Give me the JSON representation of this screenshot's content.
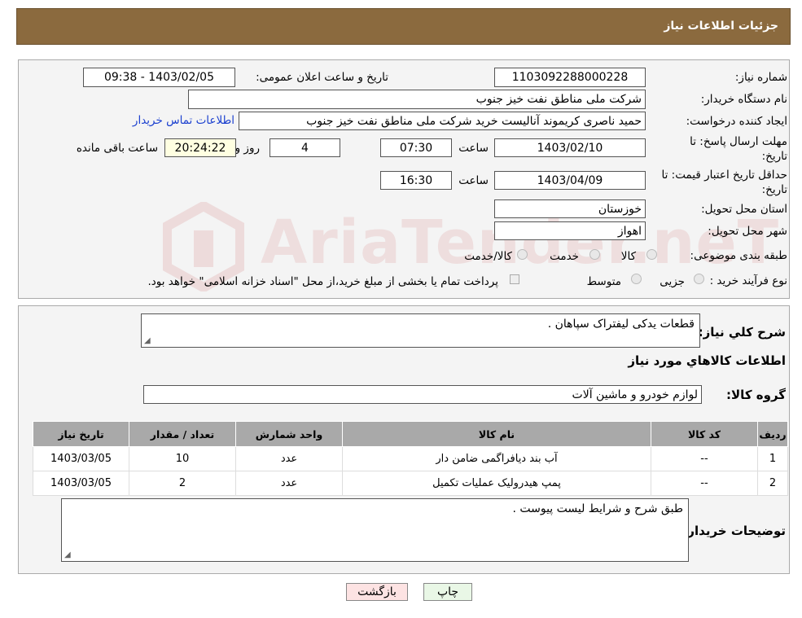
{
  "header": {
    "title": "جزئیات اطلاعات نیاز"
  },
  "form": {
    "need_number_label": "شماره نیاز:",
    "need_number": "1103092288000228",
    "announce_label": "تاریخ و ساعت اعلان عمومی:",
    "announce_value": "1403/02/05 - 09:38",
    "buyer_org_label": "نام دستگاه خریدار:",
    "buyer_org": "شرکت ملی مناطق نفت خیز جنوب",
    "creator_label": "ایجاد کننده درخواست:",
    "creator": "حمید ناصری کریموند آنالیست خرید شرکت ملی مناطق نفت خیز جنوب",
    "contact_link": "اطلاعات تماس خریدار",
    "deadline_label_1": "مهلت ارسال پاسخ: تا",
    "deadline_label_2": "تاریخ:",
    "deadline_date": "1403/02/10",
    "time_label": "ساعت",
    "deadline_time": "07:30",
    "days_value": "4",
    "days_label": "روز و",
    "remaining_value": "20:24:22",
    "remaining_label": "ساعت باقی مانده",
    "validity_label_1": "حداقل تاریخ اعتبار قیمت: تا",
    "validity_label_2": "تاریخ:",
    "validity_date": "1403/04/09",
    "validity_time": "16:30",
    "province_label": "استان محل تحویل:",
    "province": "خوزستان",
    "city_label": "شهر محل تحویل:",
    "city": "اهواز",
    "category_label": "طبقه بندی موضوعی:",
    "category_options": [
      "کالا",
      "خدمت",
      "کالا/خدمت"
    ],
    "process_label": "نوع فرآیند خرید :",
    "process_options": [
      "جزیی",
      "متوسط"
    ],
    "payment_note": "پرداخت تمام یا بخشی از مبلغ خرید،از محل \"اسناد خزانه اسلامی\" خواهد بود."
  },
  "details": {
    "desc_label": "شرح کلي نياز:",
    "desc_value": "قطعات یدکی لیفتراک سپاهان .",
    "goods_info_title": "اطلاعات کالاهاي مورد نياز",
    "goods_group_label": "گروه کالا:",
    "goods_group_value": "لوازم خودرو و ماشین آلات",
    "table": {
      "headers": [
        "رديف",
        "کد کالا",
        "نام کالا",
        "واحد شمارش",
        "تعداد / مقدار",
        "تاريخ نياز"
      ],
      "rows": [
        [
          "1",
          "--",
          "آب بند دیافراگمی ضامن دار",
          "عدد",
          "10",
          "1403/03/05"
        ],
        [
          "2",
          "--",
          "پمپ هیدرولیک عملیات تکمیل",
          "عدد",
          "2",
          "1403/03/05"
        ]
      ]
    },
    "buyer_notes_label": "توضیحات خریدار:",
    "buyer_notes_value": "طبق شرح و شرایط لیست پیوست ."
  },
  "buttons": {
    "print": "چاپ",
    "back": "بازگشت"
  },
  "watermark": "AriaTender.neT",
  "colors": {
    "header_bg": "#8b6a3e",
    "link": "#1a3fcf",
    "remaining_bg": "#ffffe1",
    "print_bg": "#e9f7e6",
    "back_bg": "#fde3e3"
  }
}
